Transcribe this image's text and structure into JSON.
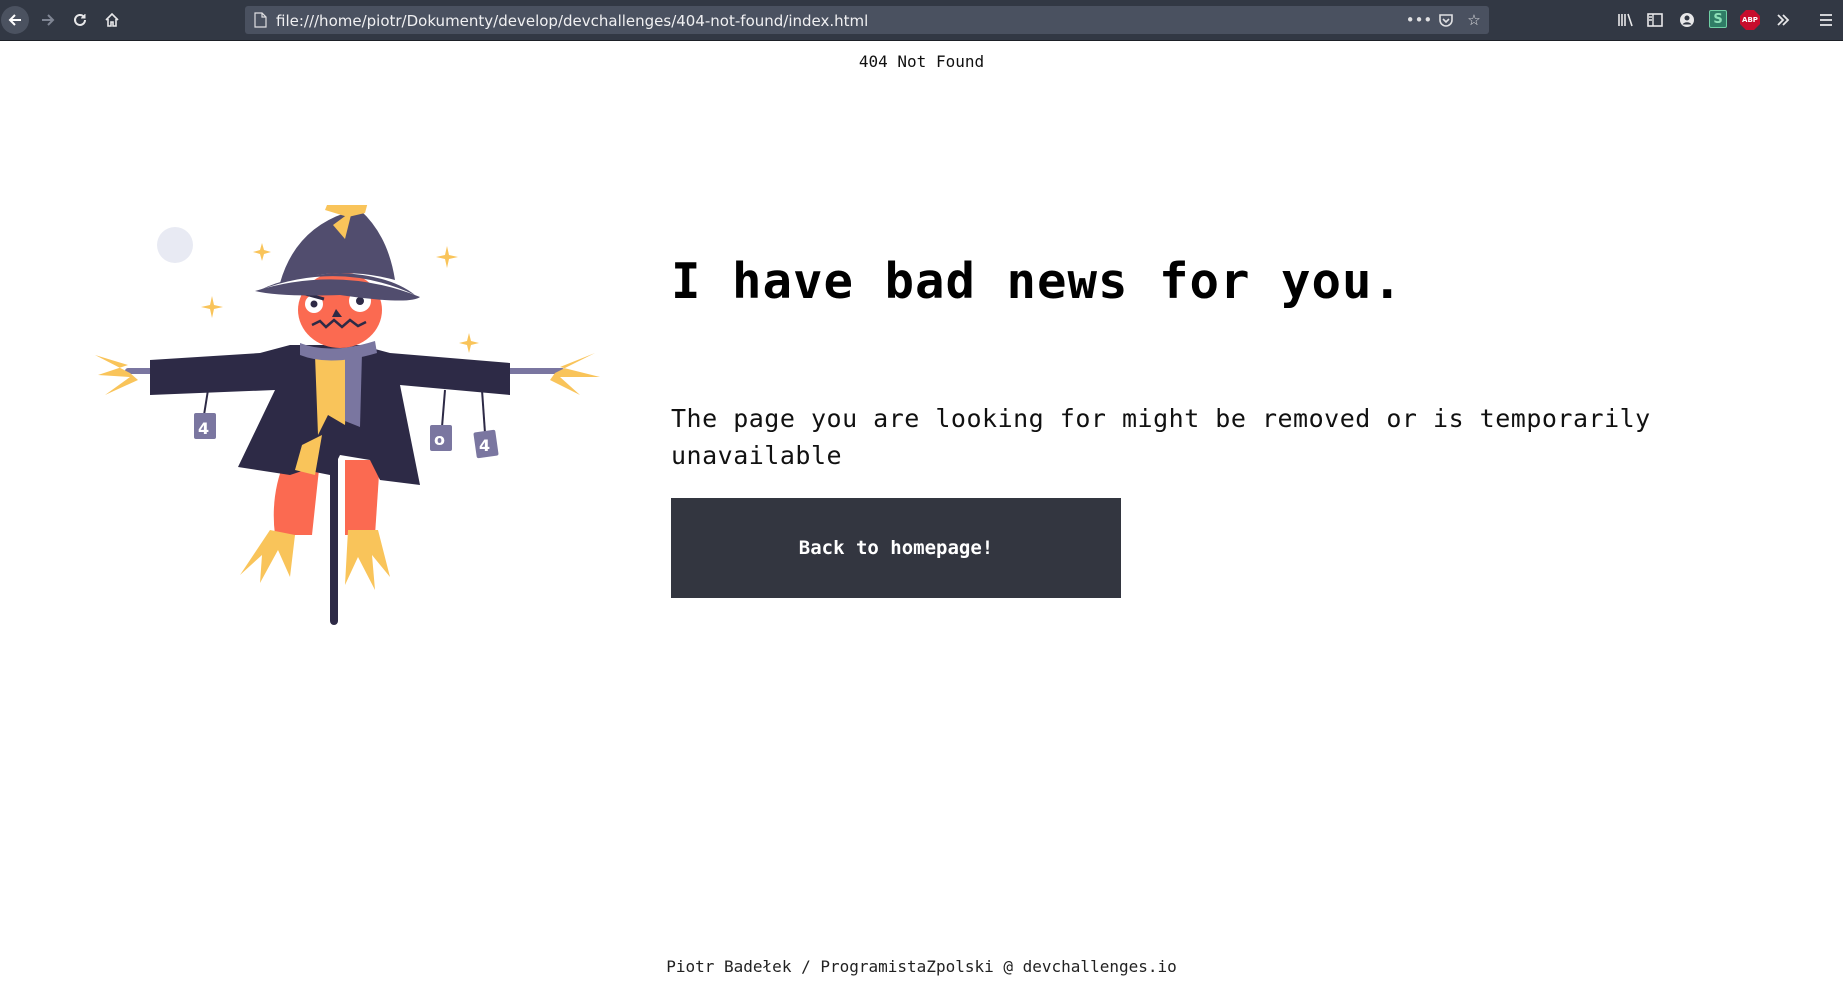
{
  "browser": {
    "url": "file:///home/piotr/Dokumenty/develop/devchallenges/404-not-found/index.html",
    "icons": [
      "back-icon",
      "forward-icon",
      "reload-icon",
      "home-icon",
      "page-icon",
      "more-icon",
      "pocket-icon",
      "bookmark-star-icon",
      "library-icon",
      "sidebar-icon",
      "account-icon",
      "s-extension-icon",
      "adblock-icon",
      "overflow-icon",
      "menu-icon"
    ],
    "abp_label": "ABP",
    "s_label": "S"
  },
  "page": {
    "top_title": "404 Not Found",
    "illustration": {
      "icon": "scarecrow-illustration",
      "can_labels": [
        "4",
        "0",
        "4"
      ]
    },
    "headline": "I have bad news for you.",
    "message": "The page you are looking for might be removed or is temporarily unavailable",
    "button_label": "Back to homepage!",
    "footer": "Piotr Badełek / ProgramistaZpolski @ devchallenges.io"
  },
  "colors": {
    "toolbar": "#323844",
    "urlbar": "#4a5160",
    "button": "#333640",
    "hat": "#514d6e",
    "face": "#fb6a51",
    "coat": "#2d2a46",
    "straw": "#f9c45a"
  }
}
